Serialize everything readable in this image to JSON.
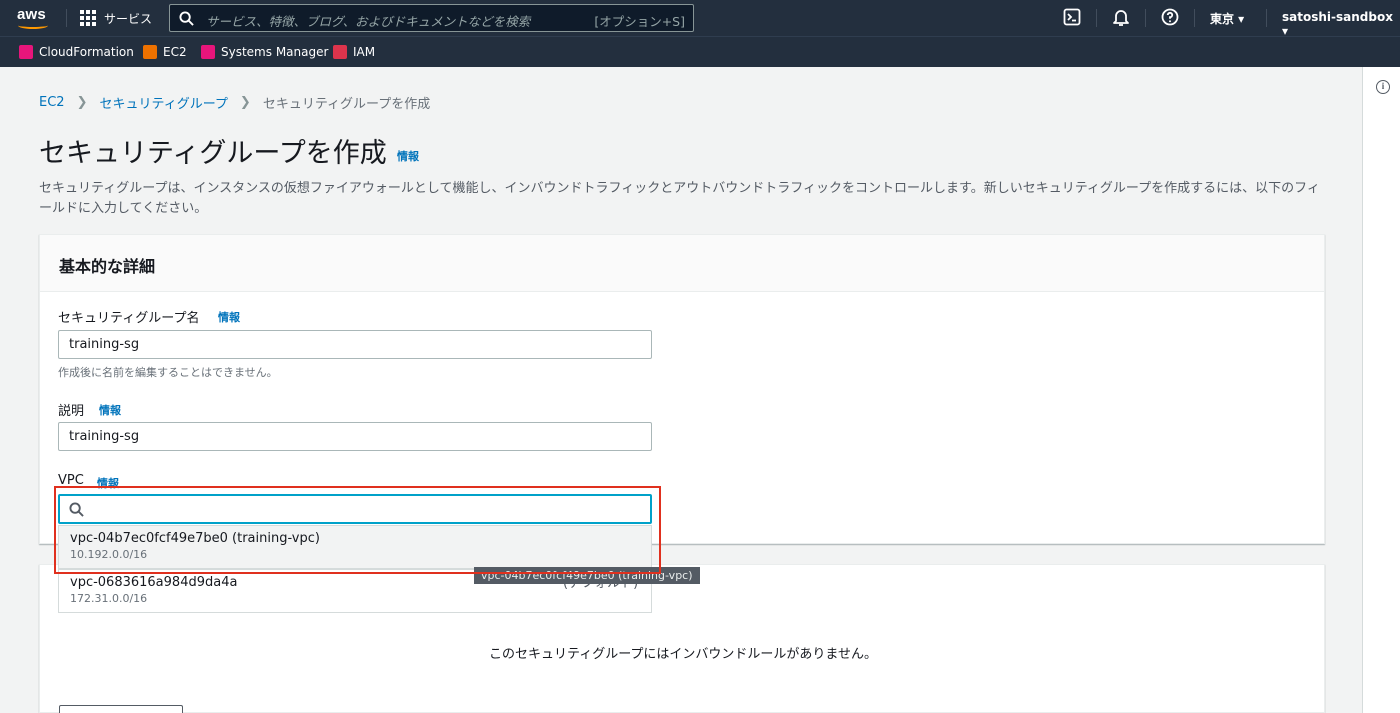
{
  "topbar": {
    "logo_text": "aws",
    "services_label": "サービス",
    "search_placeholder": "サービス、特徴、ブログ、およびドキュメントなどを検索",
    "search_shortcut": "[オプション+S]",
    "region": "東京 ▾",
    "account": "satoshi-sandbox ▾"
  },
  "favorites": [
    {
      "label": "CloudFormation",
      "color": "#e7157b"
    },
    {
      "label": "EC2",
      "color": "#ed7100"
    },
    {
      "label": "Systems Manager",
      "color": "#e7157b"
    },
    {
      "label": "IAM",
      "color": "#dd344c"
    }
  ],
  "breadcrumb": {
    "items": [
      "EC2",
      "セキュリティグループ",
      "セキュリティグループを作成"
    ]
  },
  "page": {
    "title": "セキュリティグループを作成",
    "title_info": "情報",
    "description": "セキュリティグループは、インスタンスの仮想ファイアウォールとして機能し、インバウンドトラフィックとアウトバウンドトラフィックをコントロールします。新しいセキュリティグループを作成するには、以下のフィールドに入力してください。"
  },
  "basic_details": {
    "heading": "基本的な詳細",
    "name_label": "セキュリティグループ名",
    "name_info": "情報",
    "name_value": "training-sg",
    "name_helper": "作成後に名前を編集することはできません。",
    "desc_label": "説明",
    "desc_info": "情報",
    "desc_value": "training-sg",
    "vpc_label": "VPC",
    "vpc_info": "情報",
    "vpc_search_value": ""
  },
  "vpc_options": [
    {
      "id": "vpc-04b7ec0fcf49e7be0 (training-vpc)",
      "cidr": "10.192.0.0/16"
    },
    {
      "id": "vpc-0683616a984d9da4a",
      "cidr": "172.31.0.0/16",
      "tag": "(デフォルト)"
    }
  ],
  "tooltip": "vpc-04b7ec0fcf49e7be0 (training-vpc)",
  "inbound": {
    "empty_message": "このセキュリティグループにはインバウンドルールがありません。"
  }
}
